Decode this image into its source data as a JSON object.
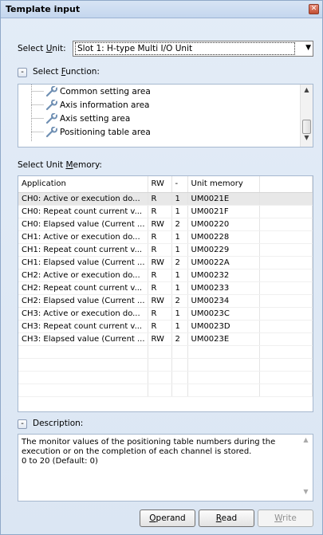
{
  "window": {
    "title": "Template input",
    "close_icon": "close-icon"
  },
  "unit": {
    "label_prefix": "Select ",
    "label_key": "U",
    "label_suffix": "nit:",
    "value": "Slot 1: H-type Multi I/O Unit"
  },
  "function": {
    "toggle": "-",
    "label_prefix": "Select ",
    "label_key": "F",
    "label_suffix": "unction:",
    "items": [
      "Common setting area",
      "Axis information area",
      "Axis setting area",
      "Positioning table area"
    ]
  },
  "memory": {
    "label_prefix": "Select Unit ",
    "label_key": "M",
    "label_suffix": "emory:",
    "columns": [
      "Application",
      "RW",
      "-",
      "Unit memory"
    ],
    "rows": [
      [
        "CH0: Active or execution do...",
        "R",
        "1",
        "UM0021E"
      ],
      [
        "CH0: Repeat count current v...",
        "R",
        "1",
        "UM0021F"
      ],
      [
        "CH0: Elapsed value (Current ...",
        "RW",
        "2",
        "UM00220"
      ],
      [
        "CH1: Active or execution do...",
        "R",
        "1",
        "UM00228"
      ],
      [
        "CH1: Repeat count current v...",
        "R",
        "1",
        "UM00229"
      ],
      [
        "CH1: Elapsed value (Current ...",
        "RW",
        "2",
        "UM0022A"
      ],
      [
        "CH2: Active or execution do...",
        "R",
        "1",
        "UM00232"
      ],
      [
        "CH2: Repeat count current v...",
        "R",
        "1",
        "UM00233"
      ],
      [
        "CH2: Elapsed value (Current ...",
        "RW",
        "2",
        "UM00234"
      ],
      [
        "CH3: Active or execution do...",
        "R",
        "1",
        "UM0023C"
      ],
      [
        "CH3: Repeat count current v...",
        "R",
        "1",
        "UM0023D"
      ],
      [
        "CH3: Elapsed value (Current ...",
        "RW",
        "2",
        "UM0023E"
      ]
    ]
  },
  "description": {
    "toggle": "-",
    "label": "Description:",
    "lines": [
      "The monitor values of the positioning table numbers during the",
      "execution or on the completion of each channel is stored.",
      "0 to 20 (Default: 0)"
    ]
  },
  "buttons": {
    "operand_key": "O",
    "operand_rest": "perand",
    "read_key": "R",
    "read_rest": "ead",
    "write_key": "W",
    "write_rest": "rite"
  }
}
